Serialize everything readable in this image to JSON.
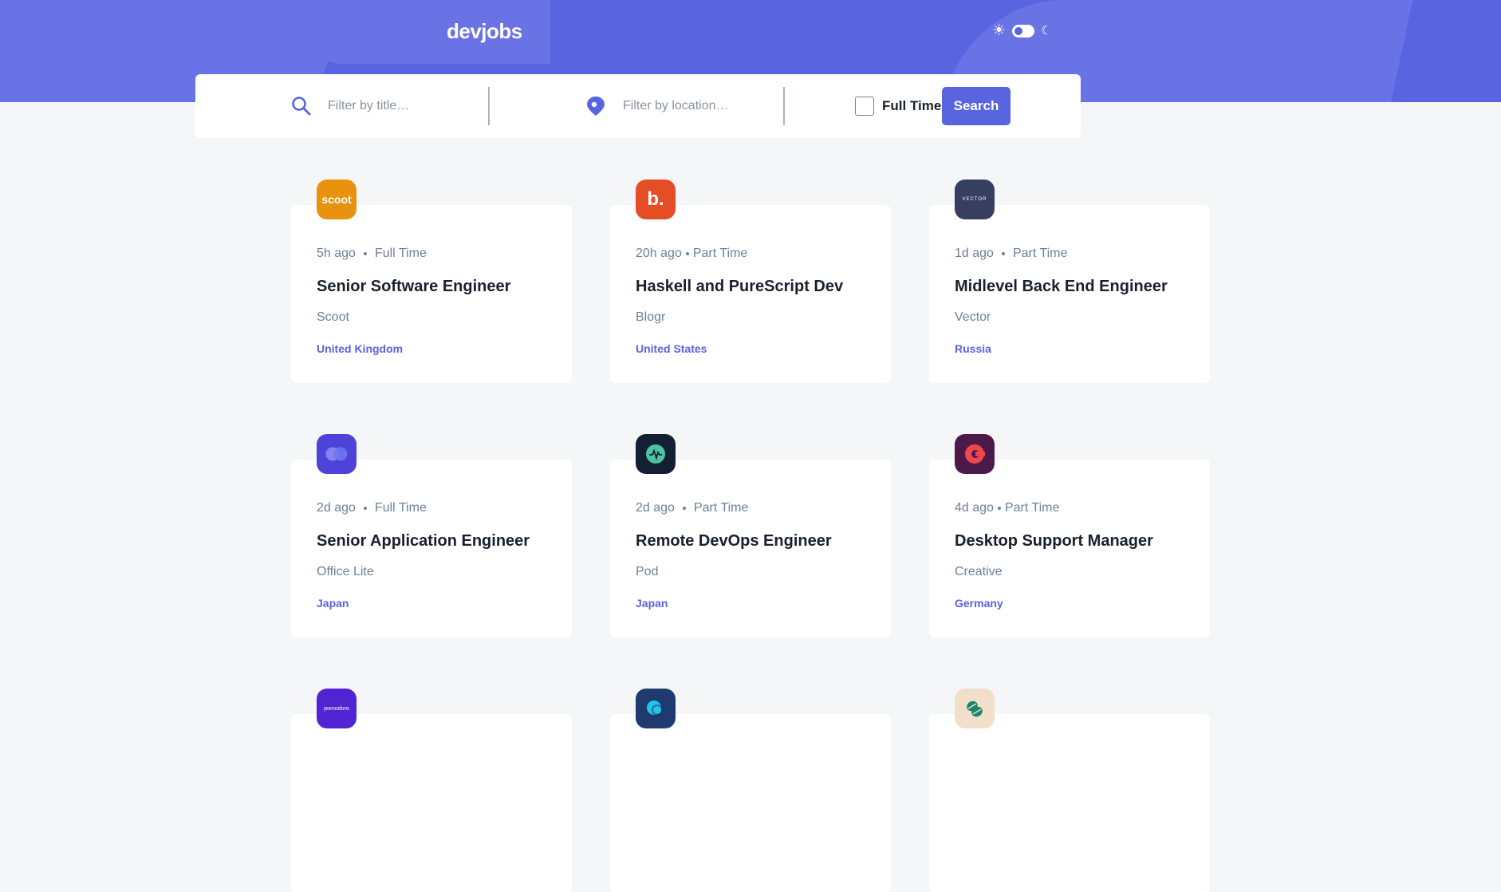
{
  "header": {
    "logo": "devjobs",
    "theme": {
      "sun_icon": "sun-icon",
      "moon_icon": "moon-icon",
      "mode": "light"
    }
  },
  "search": {
    "title_placeholder": "Filter by title…",
    "location_placeholder": "Filter by location…",
    "fulltime_label": "Full Time",
    "search_label": "Search"
  },
  "colors": {
    "accent": "#5964e0",
    "page_bg": "#f4f6f8",
    "text": "#19202d",
    "muted": "#6e8098"
  },
  "jobs": [
    {
      "posted": "5h ago",
      "contract": "Full Time",
      "title": "Senior Software Engineer",
      "company": "Scoot",
      "location": "United Kingdom",
      "logo_text": "scoot",
      "logo_bg": "#e99210"
    },
    {
      "posted": "20h ago",
      "contract": "Part Time",
      "title": "Haskell and PureScript Dev",
      "company": "Blogr",
      "location": "United States",
      "logo_text": "b.",
      "logo_bg": "#e54d26"
    },
    {
      "posted": "1d ago",
      "contract": "Part Time",
      "title": "Midlevel Back End Engineer",
      "company": "Vector",
      "location": "Russia",
      "logo_text": "VECTOR",
      "logo_bg": "#363f5f"
    },
    {
      "posted": "2d ago",
      "contract": "Full Time",
      "title": "Senior Application Engineer",
      "company": "Office Lite",
      "location": "Japan",
      "logo_text": "",
      "logo_bg": "#4e43d8"
    },
    {
      "posted": "2d ago",
      "contract": "Part Time",
      "title": "Remote DevOps Engineer",
      "company": "Pod",
      "location": "Japan",
      "logo_text": "",
      "logo_bg": "#132034"
    },
    {
      "posted": "4d ago",
      "contract": "Part Time",
      "title": "Desktop Support Manager",
      "company": "Creative",
      "location": "Germany",
      "logo_text": "",
      "logo_bg": "#4b1a4b"
    },
    {
      "logo_text": "pomodoro",
      "logo_bg": "#5024d2"
    },
    {
      "logo_text": "",
      "logo_bg": "#1f3a6e"
    },
    {
      "logo_text": "",
      "logo_bg": "#f2dfca"
    }
  ]
}
